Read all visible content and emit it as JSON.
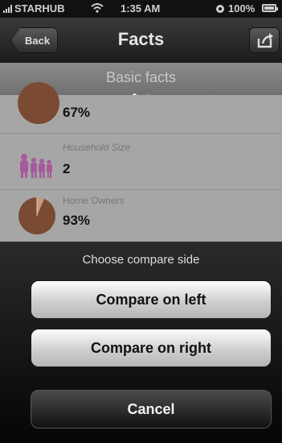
{
  "status_bar": {
    "carrier": "STARHUB",
    "time": "1:35 AM",
    "battery": "100%"
  },
  "nav": {
    "back_label": "Back",
    "title": "Facts",
    "share_icon": "share-icon"
  },
  "section": {
    "title": "Basic facts",
    "page_dots": 2,
    "active_page": 1
  },
  "facts": [
    {
      "label": "",
      "value": "67%",
      "icon": "pie-chart-icon"
    },
    {
      "label": "Household Size",
      "value": "2",
      "icon": "household-people-icon"
    },
    {
      "label": "Home Owners",
      "value": "93%",
      "icon": "pie-chart-icon"
    }
  ],
  "sheet": {
    "title": "Choose compare side",
    "compare_left": "Compare on left",
    "compare_right": "Compare on right",
    "cancel": "Cancel"
  },
  "colors": {
    "pie": "#7a4a32",
    "household": "#a55a9c",
    "background_overlay": "#a9a9a9"
  }
}
